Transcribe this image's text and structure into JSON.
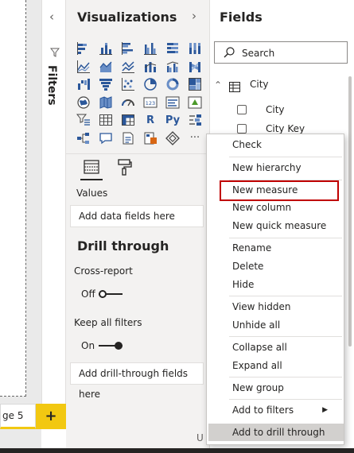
{
  "page_tab": {
    "label": "ge 5",
    "add_label": "+"
  },
  "filters_pane": {
    "label": "Filters",
    "collapse_glyph": "‹",
    "filter_icon": "filter-icon"
  },
  "visualizations": {
    "title": "Visualizations",
    "icons": [
      "stacked-bar-chart-icon",
      "stacked-column-chart-icon",
      "clustered-bar-chart-icon",
      "clustered-column-chart-icon",
      "100-stacked-bar-chart-icon",
      "100-stacked-column-chart-icon",
      "line-chart-icon",
      "area-chart-icon",
      "stacked-area-chart-icon",
      "line-and-column-chart-icon",
      "line-and-clustered-column-chart-icon",
      "ribbon-chart-icon",
      "waterfall-chart-icon",
      "funnel-chart-icon",
      "scatter-chart-icon",
      "pie-chart-icon",
      "donut-chart-icon",
      "treemap-icon",
      "map-icon",
      "filled-map-icon",
      "gauge-icon",
      "card-icon",
      "multi-row-card-icon",
      "kpi-icon",
      "slicer-icon",
      "table-icon",
      "matrix-icon",
      "r-script-icon",
      "python-visual-icon",
      "key-influencers-icon",
      "decomposition-tree-icon",
      "qa-icon",
      "smart-narrative-icon",
      "paginated-report-icon",
      "power-apps-icon",
      "more-visuals-icon"
    ],
    "r_label": "R",
    "py_label": "Py",
    "card_label": "123",
    "more_label": "···",
    "tabs": [
      "fields-tab-icon",
      "format-paintbrush-icon"
    ],
    "values_label": "Values",
    "values_placeholder": "Add data fields here",
    "drill_through_title": "Drill through",
    "cross_report_label": "Cross-report",
    "cross_report_state": "Off",
    "keep_all_filters_label": "Keep all filters",
    "keep_all_filters_state": "On",
    "drill_placeholder": "Add drill-through fields here"
  },
  "fields": {
    "title": "Fields",
    "search_placeholder": "Search",
    "table": {
      "name": "City",
      "expanded": true
    },
    "items": [
      "City",
      "City Key"
    ]
  },
  "context_menu": {
    "items": [
      "Check",
      "New hierarchy",
      "New measure",
      "New column",
      "New quick measure",
      "Rename",
      "Delete",
      "Hide",
      "View hidden",
      "Unhide all",
      "Collapse all",
      "Expand all",
      "New group",
      "Add to filters",
      "Add to drill through"
    ],
    "highlighted_item": "New measure",
    "hovered_item": "Add to drill through",
    "highlight_color": "#c00000"
  },
  "status_text": "U"
}
